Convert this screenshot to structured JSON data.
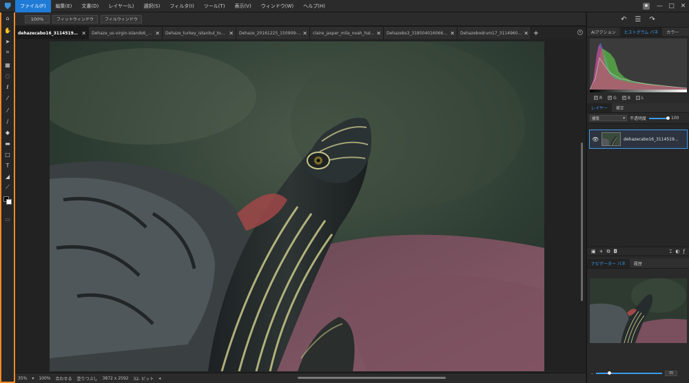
{
  "menubar": {
    "items": [
      {
        "label": "ファイル(F)",
        "active": true
      },
      {
        "label": "編集(E)",
        "active": false
      },
      {
        "label": "文書(D)",
        "active": false
      },
      {
        "label": "レイヤー(L)",
        "active": false
      },
      {
        "label": "選択(S)",
        "active": false
      },
      {
        "label": "フィルタ(I)",
        "active": false
      },
      {
        "label": "ツール(T)",
        "active": false
      },
      {
        "label": "表示(V)",
        "active": false
      },
      {
        "label": "ウィンドウ(W)",
        "active": false
      },
      {
        "label": "ヘルプ(H)",
        "active": false
      }
    ],
    "accent_color": "#1f7bd6"
  },
  "window_controls": {
    "minimize": "—",
    "maximize": "□",
    "close": "✕"
  },
  "options": {
    "zoom": "100%",
    "fit_window": "フィットウィンドウ",
    "fill_window": "フィルウィンドウ"
  },
  "tabs": [
    {
      "label": "dehazecabo16_311451977…",
      "active": true
    },
    {
      "label": "Dehaze_us-virgin-islands6_32…",
      "active": false
    },
    {
      "label": "Dehaze_turkey_istanbul_topkap…",
      "active": false
    },
    {
      "label": "Dehaze_20161225_150909-edit…",
      "active": false
    },
    {
      "label": "claire_jasper_mila_noah_haley…",
      "active": false
    },
    {
      "label": "Dehazebs3_318504016066_o.jpe",
      "active": false
    },
    {
      "label": "Dehazebodrum17_3114960735…",
      "active": false
    }
  ],
  "status": {
    "zoom": "35%",
    "view_zoom": "100%",
    "fit": "合わせる",
    "fill": "塗りつぶし",
    "dimensions": "3872 x 2592",
    "bits": "32- ビット"
  },
  "right_panel": {
    "top_tabs": [
      "AIアクション",
      "ヒストグラム パネ",
      "カラー"
    ],
    "top_active": 1,
    "channels": [
      {
        "label": "R",
        "checked": true
      },
      {
        "label": "G",
        "checked": true
      },
      {
        "label": "B",
        "checked": true
      },
      {
        "label": "L",
        "checked": false
      }
    ],
    "layer_tabs": [
      "レイヤー",
      "補正"
    ],
    "layer_active": 0,
    "blend_mode": "標準",
    "opacity_label": "不透明度",
    "opacity_value": "100",
    "opacity_fraction": 1.0,
    "layer_name": "dehazecabo16_311451977314…",
    "nav_tabs": [
      "ナビゲーター パネ",
      "履歴"
    ],
    "nav_active": 0,
    "nav_zoom": "35",
    "nav_zoom_fraction": 0.2
  },
  "icons": {
    "toolbar": [
      "home-icon",
      "hand-icon",
      "move-icon",
      "crop-transform-icon",
      "marquee-rect-icon",
      "marquee-ellipse-icon",
      "lasso-icon",
      "magic-wand-icon",
      "eyedropper-icon",
      "brush-icon",
      "fill-bucket-icon",
      "healing-icon",
      "shape-icon",
      "text-icon",
      "eraser-icon",
      "line-icon"
    ]
  }
}
